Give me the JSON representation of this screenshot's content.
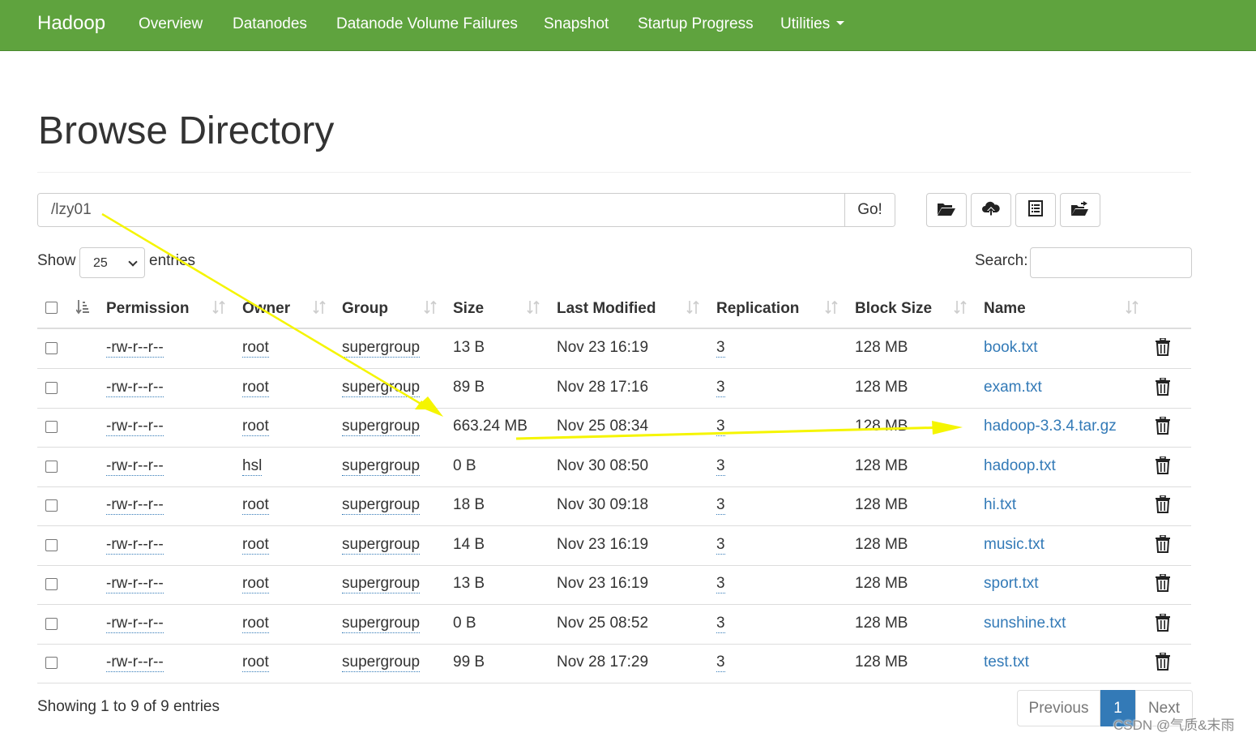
{
  "navbar": {
    "brand": "Hadoop",
    "items": [
      {
        "label": "Overview"
      },
      {
        "label": "Datanodes"
      },
      {
        "label": "Datanode Volume Failures"
      },
      {
        "label": "Snapshot"
      },
      {
        "label": "Startup Progress"
      },
      {
        "label": "Utilities"
      }
    ],
    "color": "#5fa33e"
  },
  "page": {
    "title": "Browse Directory"
  },
  "pathbar": {
    "path": "/lzy01",
    "go_label": "Go!"
  },
  "toolbar": {
    "icons": [
      "folder-open-icon",
      "cloud-upload-icon",
      "list-icon",
      "folder-move-icon"
    ]
  },
  "controls": {
    "show_label": "Show",
    "page_size": "25",
    "entries_label": "entries",
    "search_label": "Search:"
  },
  "table": {
    "columns": [
      "Permission",
      "Owner",
      "Group",
      "Size",
      "Last Modified",
      "Replication",
      "Block Size",
      "Name"
    ],
    "rows": [
      {
        "permission": "-rw-r--r--",
        "owner": "root",
        "group": "supergroup",
        "size": "13 B",
        "modified": "Nov 23 16:19",
        "replication": "3",
        "block_size": "128 MB",
        "name": "book.txt"
      },
      {
        "permission": "-rw-r--r--",
        "owner": "root",
        "group": "supergroup",
        "size": "89 B",
        "modified": "Nov 28 17:16",
        "replication": "3",
        "block_size": "128 MB",
        "name": "exam.txt"
      },
      {
        "permission": "-rw-r--r--",
        "owner": "root",
        "group": "supergroup",
        "size": "663.24 MB",
        "modified": "Nov 25 08:34",
        "replication": "3",
        "block_size": "128 MB",
        "name": "hadoop-3.3.4.tar.gz"
      },
      {
        "permission": "-rw-r--r--",
        "owner": "hsl",
        "group": "supergroup",
        "size": "0 B",
        "modified": "Nov 30 08:50",
        "replication": "3",
        "block_size": "128 MB",
        "name": "hadoop.txt"
      },
      {
        "permission": "-rw-r--r--",
        "owner": "root",
        "group": "supergroup",
        "size": "18 B",
        "modified": "Nov 30 09:18",
        "replication": "3",
        "block_size": "128 MB",
        "name": "hi.txt"
      },
      {
        "permission": "-rw-r--r--",
        "owner": "root",
        "group": "supergroup",
        "size": "14 B",
        "modified": "Nov 23 16:19",
        "replication": "3",
        "block_size": "128 MB",
        "name": "music.txt"
      },
      {
        "permission": "-rw-r--r--",
        "owner": "root",
        "group": "supergroup",
        "size": "13 B",
        "modified": "Nov 23 16:19",
        "replication": "3",
        "block_size": "128 MB",
        "name": "sport.txt"
      },
      {
        "permission": "-rw-r--r--",
        "owner": "root",
        "group": "supergroup",
        "size": "0 B",
        "modified": "Nov 25 08:52",
        "replication": "3",
        "block_size": "128 MB",
        "name": "sunshine.txt"
      },
      {
        "permission": "-rw-r--r--",
        "owner": "root",
        "group": "supergroup",
        "size": "99 B",
        "modified": "Nov 28 17:29",
        "replication": "3",
        "block_size": "128 MB",
        "name": "test.txt"
      }
    ]
  },
  "footer": {
    "info": "Showing 1 to 9 of 9 entries",
    "previous": "Previous",
    "current_page": "1",
    "next": "Next"
  },
  "watermark": "CSDN @气质&末雨",
  "colors": {
    "link": "#337ab7",
    "annotation_arrow": "#f5f500"
  }
}
